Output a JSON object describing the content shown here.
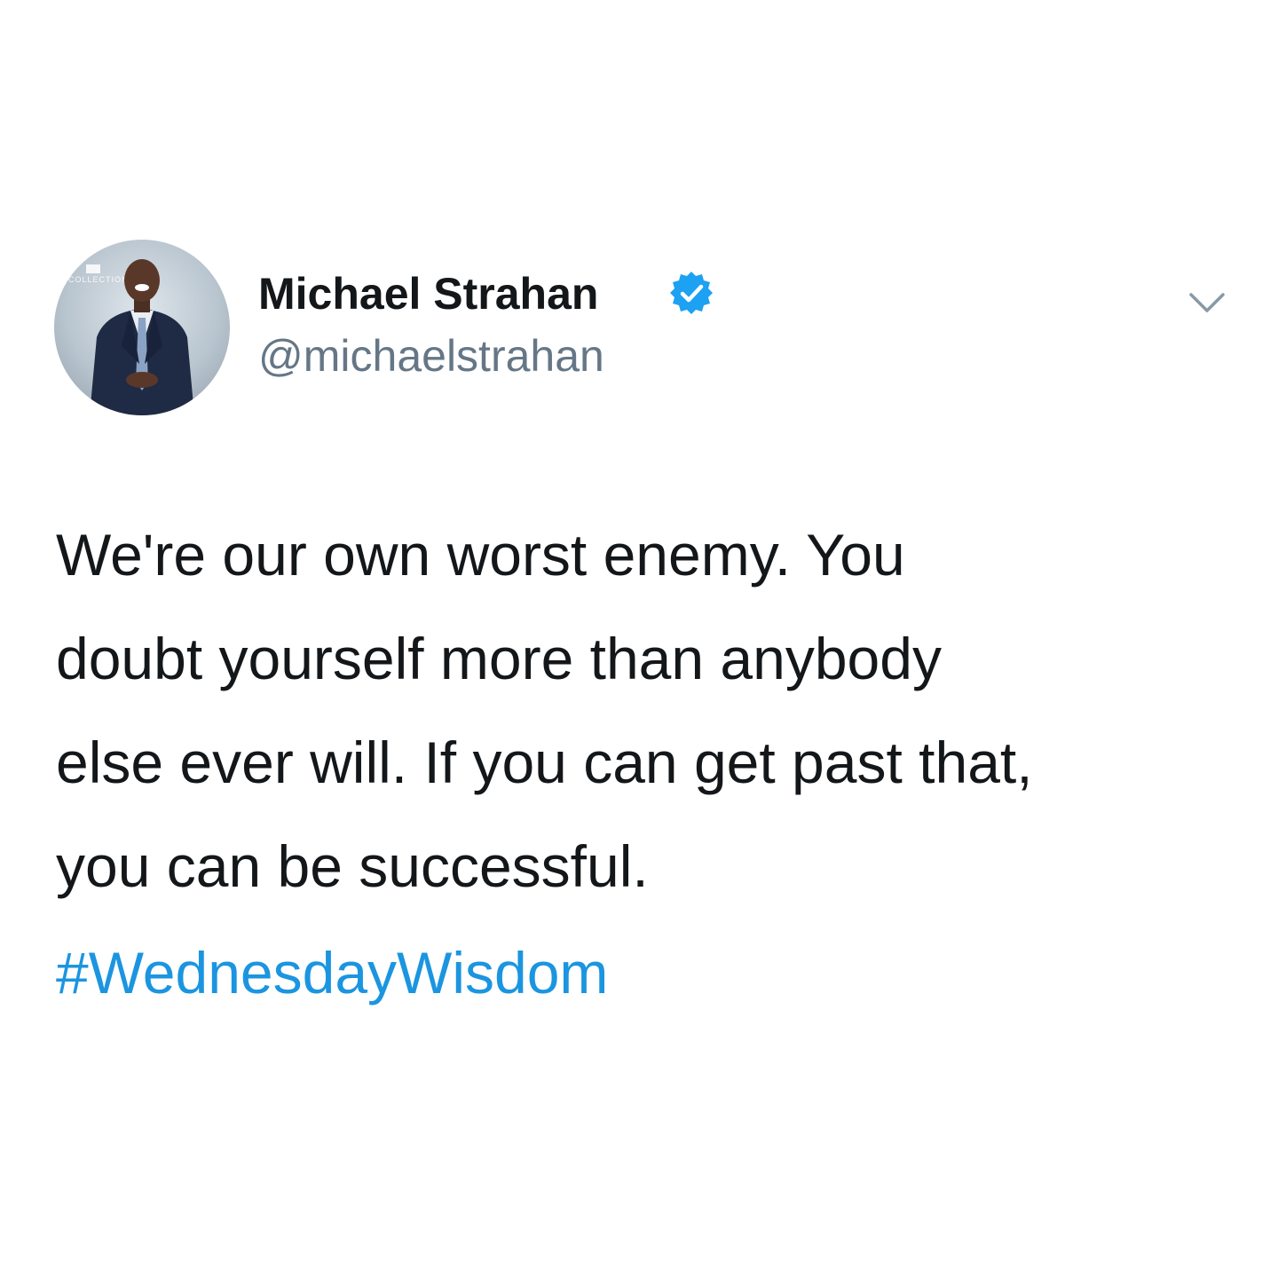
{
  "author": {
    "display_name": "Michael Strahan",
    "handle": "@michaelstrahan",
    "verified": true,
    "avatar_watermark": "COLLECTION"
  },
  "tweet": {
    "lines": [
      "We're our own worst enemy. You",
      "doubt yourself more than anybody",
      "else ever will. If you can get past that,",
      "you can be successful."
    ],
    "hashtag": "#WednesdayWisdom"
  },
  "icons": {
    "verified": "verified-badge-icon",
    "menu": "chevron-down-icon"
  },
  "colors": {
    "verified_badge": "#1da1f2",
    "hashtag": "#1b95e0",
    "handle": "#657786",
    "text": "#14171a",
    "caret": "#8899a6"
  }
}
